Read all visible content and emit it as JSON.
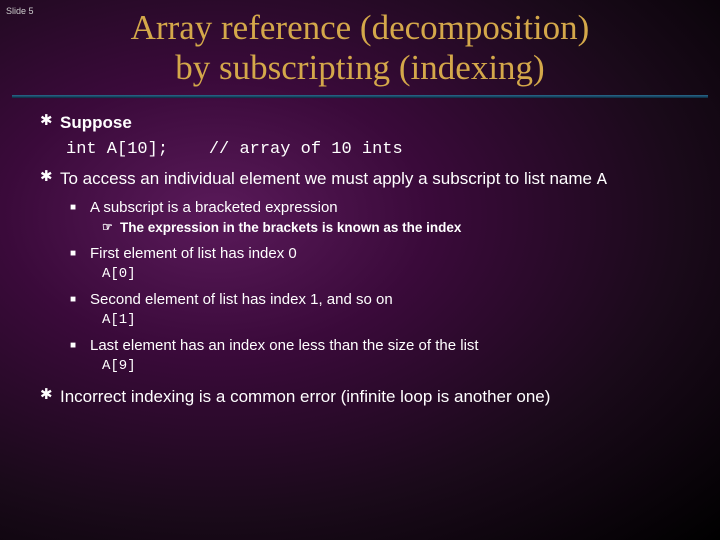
{
  "slide_number": "Slide 5",
  "title_line1": "Array reference  (decomposition)",
  "title_line2": "by subscripting (indexing)",
  "bullets": {
    "b1a": "Suppose",
    "code1a": "int A[10];",
    "code1b": "// array of 10 ints",
    "b1b_pre": "To access an individual element we must apply a subscript to list name ",
    "b1b_code": "A",
    "b2a": "A subscript is a bracketed expression",
    "b3a": "The expression in the brackets is known as the index",
    "b2b": "First element of list has index 0",
    "code_b2b": "A[0]",
    "b2c": "Second element of list has index 1, and so on",
    "code_b2c": "A[1]",
    "b2d": "Last element has an index one less than the size of the list",
    "code_b2d": "A[9]",
    "b1c": "Incorrect indexing is a common error (infinite loop is another one)"
  },
  "markers": {
    "l1": "✱",
    "l2": "■",
    "l3": "☞"
  }
}
